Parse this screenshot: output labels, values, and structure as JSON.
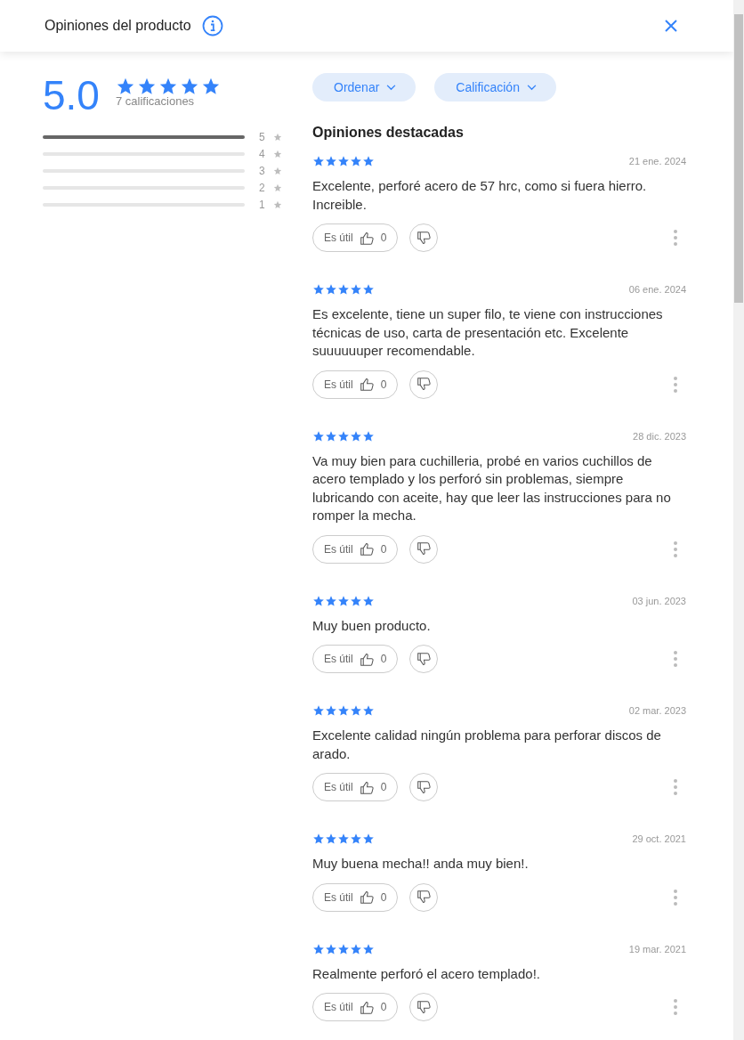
{
  "header": {
    "title": "Opiniones del producto"
  },
  "summary": {
    "average": "5.0",
    "stars": 5,
    "count": "7 calificaciones",
    "histogram": [
      {
        "label": "5",
        "level": 1
      },
      {
        "label": "4",
        "level": 0
      },
      {
        "label": "3",
        "level": 0
      },
      {
        "label": "2",
        "level": 0
      },
      {
        "label": "1",
        "level": 0
      }
    ]
  },
  "filters": [
    "Ordenar",
    "Calificación"
  ],
  "section_title": "Opiniones destacadas",
  "reviews": [
    {
      "stars": 5,
      "date": "21 ene. 2024",
      "text": "Excelente, perforé acero de 57 hrc, como si fuera hierro. Increible.",
      "helpful_label": "Es útil",
      "helpful_count": "0"
    },
    {
      "stars": 5,
      "date": "06 ene. 2024",
      "text": "Es excelente, tiene un super filo, te viene con instrucciones técnicas de uso, carta de presentación etc. Excelente suuuuuuper recomendable.",
      "helpful_label": "Es útil",
      "helpful_count": "0"
    },
    {
      "stars": 5,
      "date": "28 dic. 2023",
      "text": "Va muy bien para cuchilleria, probé en varios cuchillos de acero templado y los perforó sin problemas, siempre lubricando con aceite, hay que leer las instrucciones para no romper la mecha.",
      "helpful_label": "Es útil",
      "helpful_count": "0"
    },
    {
      "stars": 5,
      "date": "03 jun. 2023",
      "text": "Muy buen producto.",
      "helpful_label": "Es útil",
      "helpful_count": "0"
    },
    {
      "stars": 5,
      "date": "02 mar. 2023",
      "text": "Excelente calidad ningún problema para perforar discos de arado.",
      "helpful_label": "Es útil",
      "helpful_count": "0"
    },
    {
      "stars": 5,
      "date": "29 oct. 2021",
      "text": "Muy buena mecha!! anda muy bien!.",
      "helpful_label": "Es útil",
      "helpful_count": "0"
    },
    {
      "stars": 5,
      "date": "19 mar. 2021",
      "text": "Realmente perforó el acero templado!.",
      "helpful_label": "Es útil",
      "helpful_count": "0"
    }
  ]
}
